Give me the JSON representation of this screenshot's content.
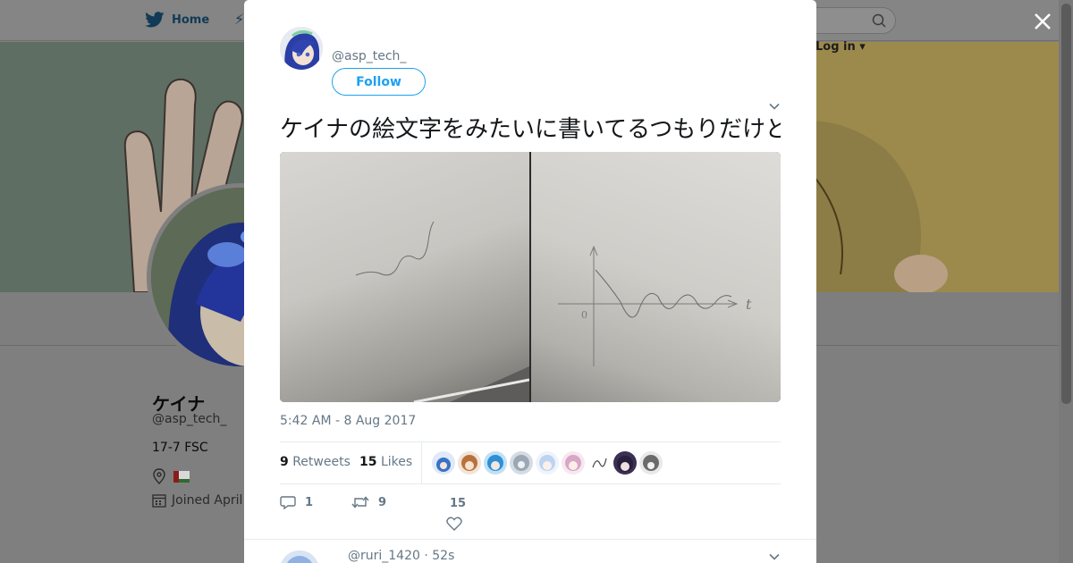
{
  "nav": {
    "home_label": "Home",
    "login_label": "Log in"
  },
  "profile": {
    "name": "ケイナ",
    "handle": "@asp_tech_",
    "bio": "17-7 FSC",
    "joined": "Joined April"
  },
  "tweet": {
    "author_handle": "@asp_tech_",
    "follow_label": "Follow",
    "text": "ケイナの絵文字をみたいに書いてるつもりだけど誰か表情やっている",
    "timestamp": "5:42 AM - 8 Aug 2017",
    "retweets_count": "9",
    "retweets_label": "Retweets",
    "likes_count": "15",
    "likes_label": "Likes",
    "reply_count": "1",
    "retweet_action_count": "9",
    "like_action_count": "15",
    "graph_t_label": "t",
    "graph_origin_label": "0"
  },
  "reply": {
    "handle": "@ruri_1420",
    "age": "52s"
  },
  "colors": {
    "accent": "#1da1f2",
    "secondary_text": "#657786",
    "overlay": "#7f7f7f"
  },
  "icons": [
    "twitter-bird-icon",
    "search-icon",
    "close-icon",
    "chevron-down-icon",
    "location-icon",
    "calendar-icon",
    "reply-icon",
    "retweet-icon",
    "heart-icon"
  ]
}
